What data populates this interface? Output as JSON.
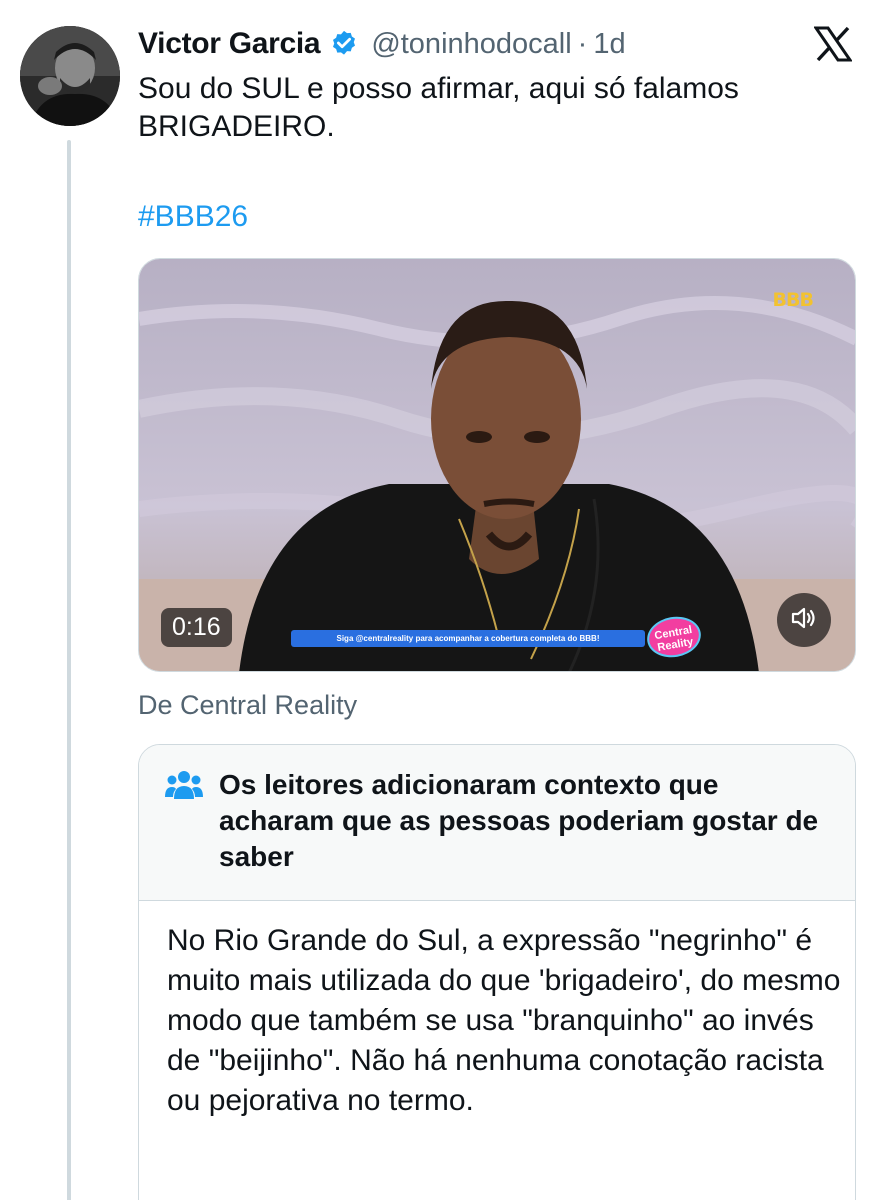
{
  "tweet": {
    "author_name": "Victor Garcia",
    "handle": "@toninhodocall",
    "separator": "·",
    "time": "1d",
    "text": "Sou do SUL e posso afirmar, aqui só falamos BRIGADEIRO.",
    "hashtag": "#BBB26",
    "icons": {
      "verified": "verified-badge-icon",
      "logo": "x-logo-icon"
    },
    "accent_color": "#1d9bf0"
  },
  "media": {
    "overlay_logo": "BBB",
    "duration": "0:16",
    "banner_text": "Siga @centralreality para acompanhar a cobertura completa do BBB!",
    "channel_logo": "Central Reality",
    "sound_icon": "speaker-icon"
  },
  "source": "De Central Reality",
  "community_note": {
    "title": "Os leitores adicionaram contexto que acharam que as pessoas poderiam gostar de saber",
    "icon": "people-icon",
    "body": "No Rio Grande do Sul, a expressão \"negrinho\" é muito mais utilizada do que 'brigadeiro', do mesmo modo que também se usa \"branquinho\" ao invés de \"beijinho\". Não há nenhuma conotação racista ou pejorativa no termo."
  }
}
